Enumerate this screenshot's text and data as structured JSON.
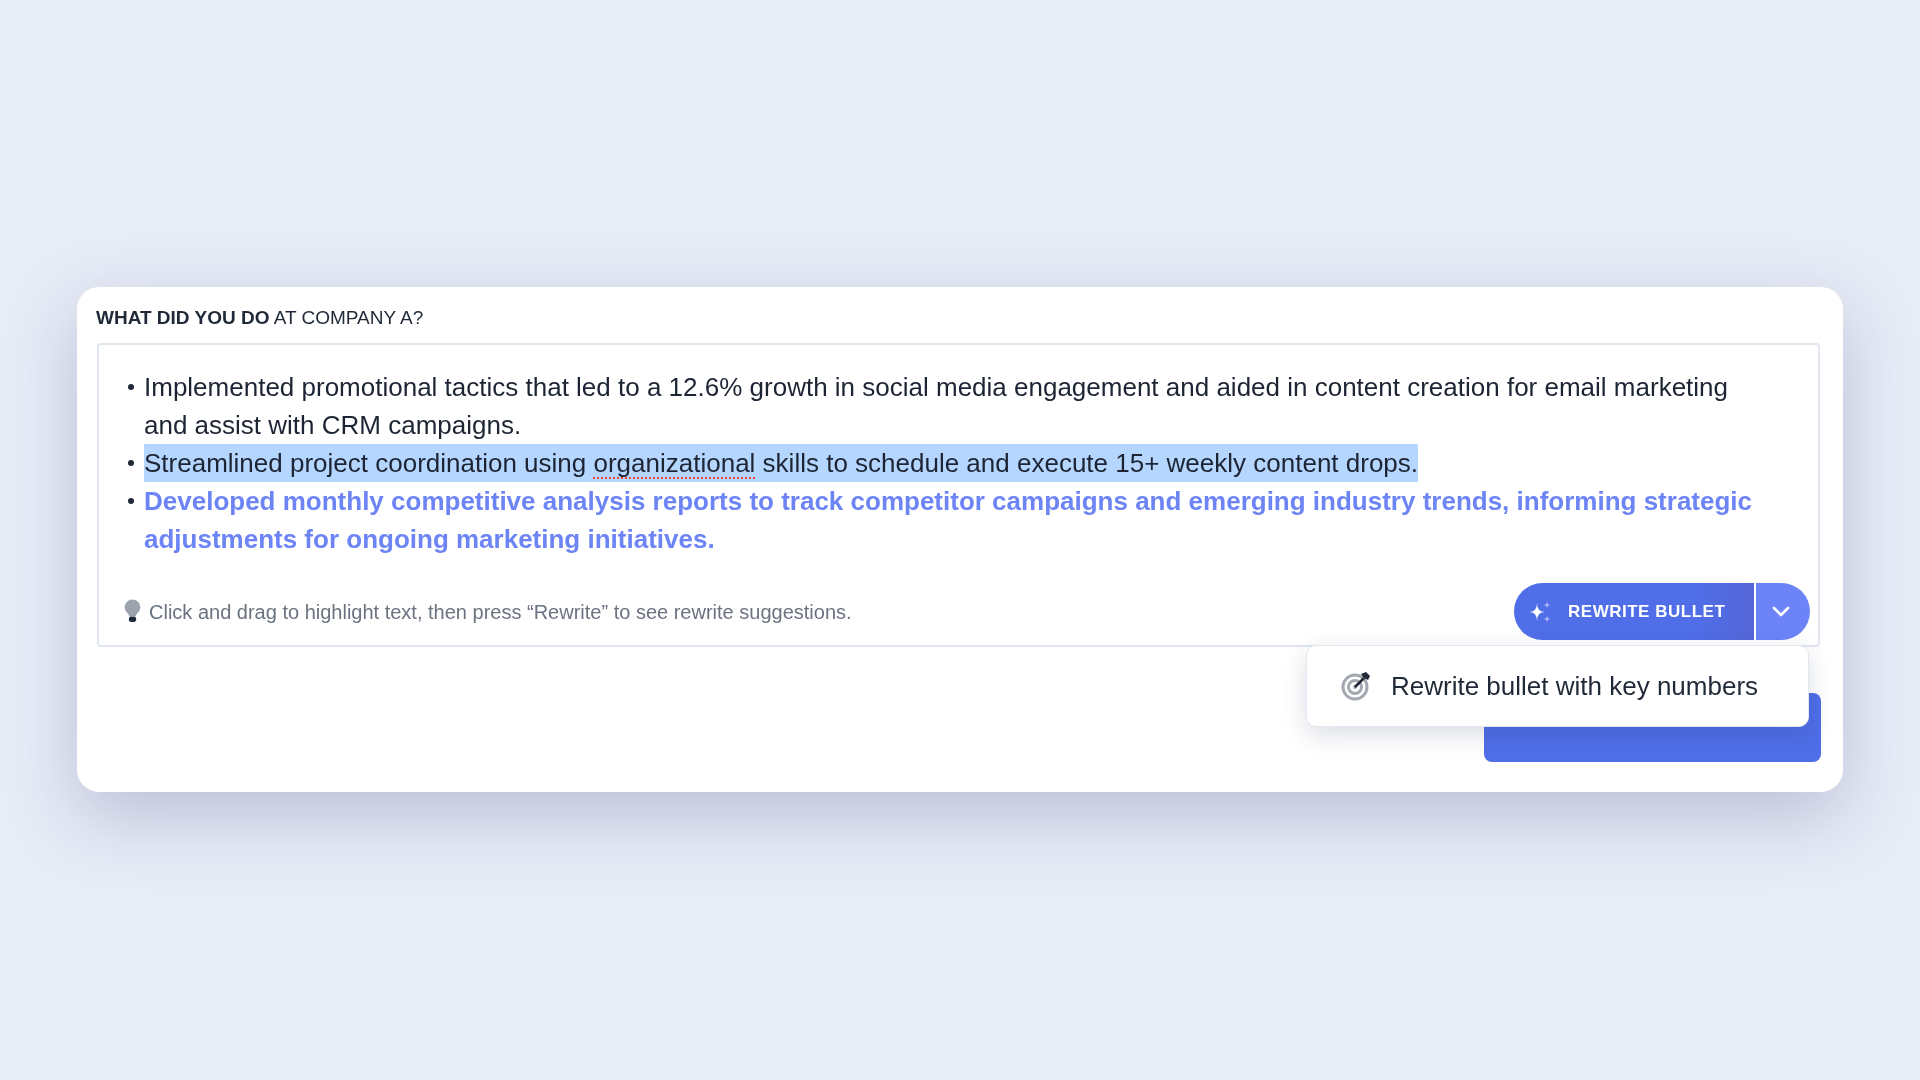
{
  "question": {
    "label": "**WHAT DID YOU DO** AT COMPANY A?"
  },
  "editor": {
    "bullets": [
      {
        "kind": "plain",
        "selected": false,
        "segments": [
          {
            "text": "Implemented promotional tactics that led to a 12.6% growth in social media engagement and aided in content creation for email marketing and assist with CRM campaigns.",
            "misspelled": false
          }
        ]
      },
      {
        "kind": "plain",
        "selected": true,
        "segments": [
          {
            "text": "Streamlined project coordination using ",
            "misspelled": false
          },
          {
            "text": "organizational",
            "misspelled": true
          },
          {
            "text": " skills to schedule and execute 15+ weekly content drops.",
            "misspelled": false
          }
        ]
      },
      {
        "kind": "suggestion",
        "selected": false,
        "segments": [
          {
            "text": "Developed monthly competitive analysis reports to track competitor campaigns and emerging industry trends, informing strategic adjustments for ongoing marketing initiatives.",
            "misspelled": false
          }
        ]
      }
    ],
    "hint": "Click and drag to highlight text, then press “Rewrite” to see rewrite suggestions.",
    "rewrite_button": {
      "label": "REWRITE BULLET",
      "expanded": true
    }
  },
  "menu": {
    "items": [
      {
        "label": "Rewrite bullet with key numbers"
      }
    ]
  }
}
